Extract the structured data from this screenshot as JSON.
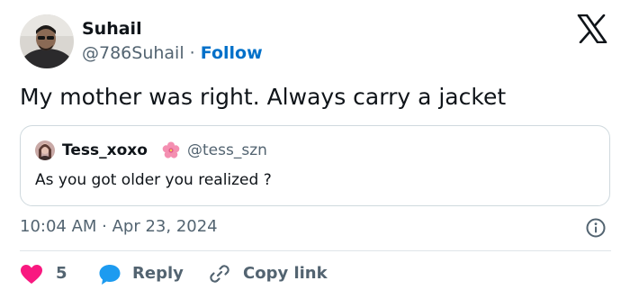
{
  "author": {
    "name": "Suhail",
    "handle": "@786Suhail",
    "separator": " · ",
    "follow_label": "Follow"
  },
  "tweet": {
    "text": "My mother was right. Always carry a jacket",
    "timestamp": "10:04 AM · Apr 23, 2024"
  },
  "quoted": {
    "name": "Tess_xoxo",
    "handle": "@tess_szn",
    "text": "As you got older you realized ?"
  },
  "actions": {
    "like_count": "5",
    "reply_label": "Reply",
    "copy_link_label": "Copy link"
  },
  "icons": {
    "brand": "x-logo-icon",
    "like": "heart-icon",
    "reply": "speech-bubble-icon",
    "copy": "link-icon",
    "info": "info-icon",
    "flower": "hibiscus-icon"
  },
  "colors": {
    "follow": "#0070c9",
    "like": "#f91880",
    "reply": "#1d9bf0",
    "muted": "#536471"
  }
}
